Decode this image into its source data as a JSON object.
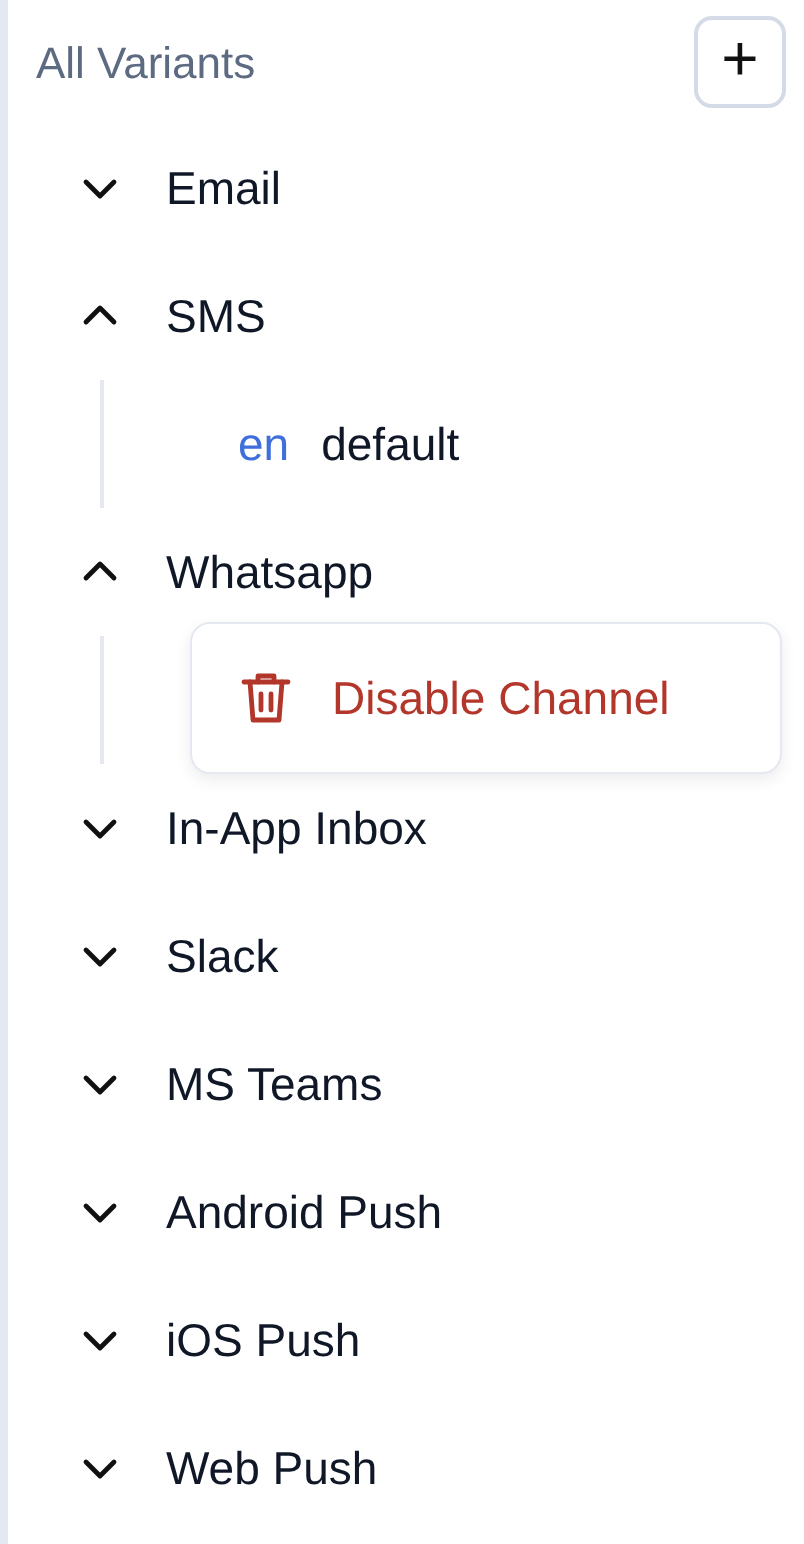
{
  "header": {
    "title": "All Variants",
    "add_button": "+"
  },
  "channels": [
    {
      "name": "Email",
      "expanded": false
    },
    {
      "name": "SMS",
      "expanded": true,
      "variants": [
        {
          "locale": "en",
          "name": "default"
        }
      ]
    },
    {
      "name": "Whatsapp",
      "expanded": true
    },
    {
      "name": "In-App Inbox",
      "expanded": false
    },
    {
      "name": "Slack",
      "expanded": false
    },
    {
      "name": "MS Teams",
      "expanded": false
    },
    {
      "name": "Android Push",
      "expanded": false
    },
    {
      "name": "iOS Push",
      "expanded": false
    },
    {
      "name": "Web Push",
      "expanded": false
    }
  ],
  "context_menu": {
    "items": [
      {
        "label": "Disable Channel",
        "kind": "danger"
      }
    ]
  }
}
